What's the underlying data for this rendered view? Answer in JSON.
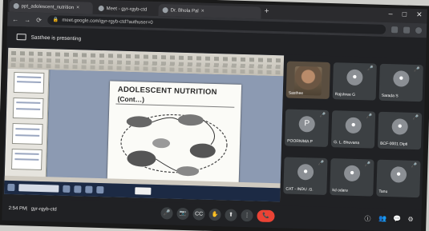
{
  "browser": {
    "tabs": [
      {
        "title": "ppt_adolescent_nutrition"
      },
      {
        "title": "Meet - gyr-rgyb-ctd"
      },
      {
        "title": "Dr. Bhola Pal"
      }
    ],
    "new_tab": "+",
    "url": "meet.google.com/gyr-rgyb-ctd?authuser=0",
    "window_controls": [
      "–",
      "□",
      "✕"
    ]
  },
  "meet": {
    "presenting_banner": "Sasthee is presenting",
    "participants": [
      {
        "name": "Sasthee",
        "type": "video"
      },
      {
        "name": "Rajshree G",
        "type": "avatar"
      },
      {
        "name": "Sarada S",
        "type": "avatar"
      },
      {
        "name": "POORNIMA P",
        "type": "letter",
        "initial": "P"
      },
      {
        "name": "G. L. Bhuvana",
        "type": "avatar"
      },
      {
        "name": "BCF-0001 Dipti",
        "type": "avatar"
      },
      {
        "name": "CAT - INDU .G.",
        "type": "avatar"
      },
      {
        "name": "kd odara",
        "type": "avatar"
      },
      {
        "name": "Tanu",
        "type": "avatar"
      }
    ],
    "clock": "2:54 PM",
    "separator": "|",
    "meeting_code": "gyr-rgyb-ctd",
    "controls": [
      "🎤",
      "📷",
      "CC",
      "✋",
      "⬆",
      "⋮",
      "📞"
    ],
    "right_controls": [
      "ⓘ",
      "👥",
      "💬",
      "⚙"
    ]
  },
  "slide": {
    "title": "ADOLESCENT NUTRITION",
    "subtitle": "(Cont…)"
  },
  "colors": {
    "end_call": "#ea4335",
    "meet_bg": "#202124",
    "tile_bg": "#3c4043"
  }
}
